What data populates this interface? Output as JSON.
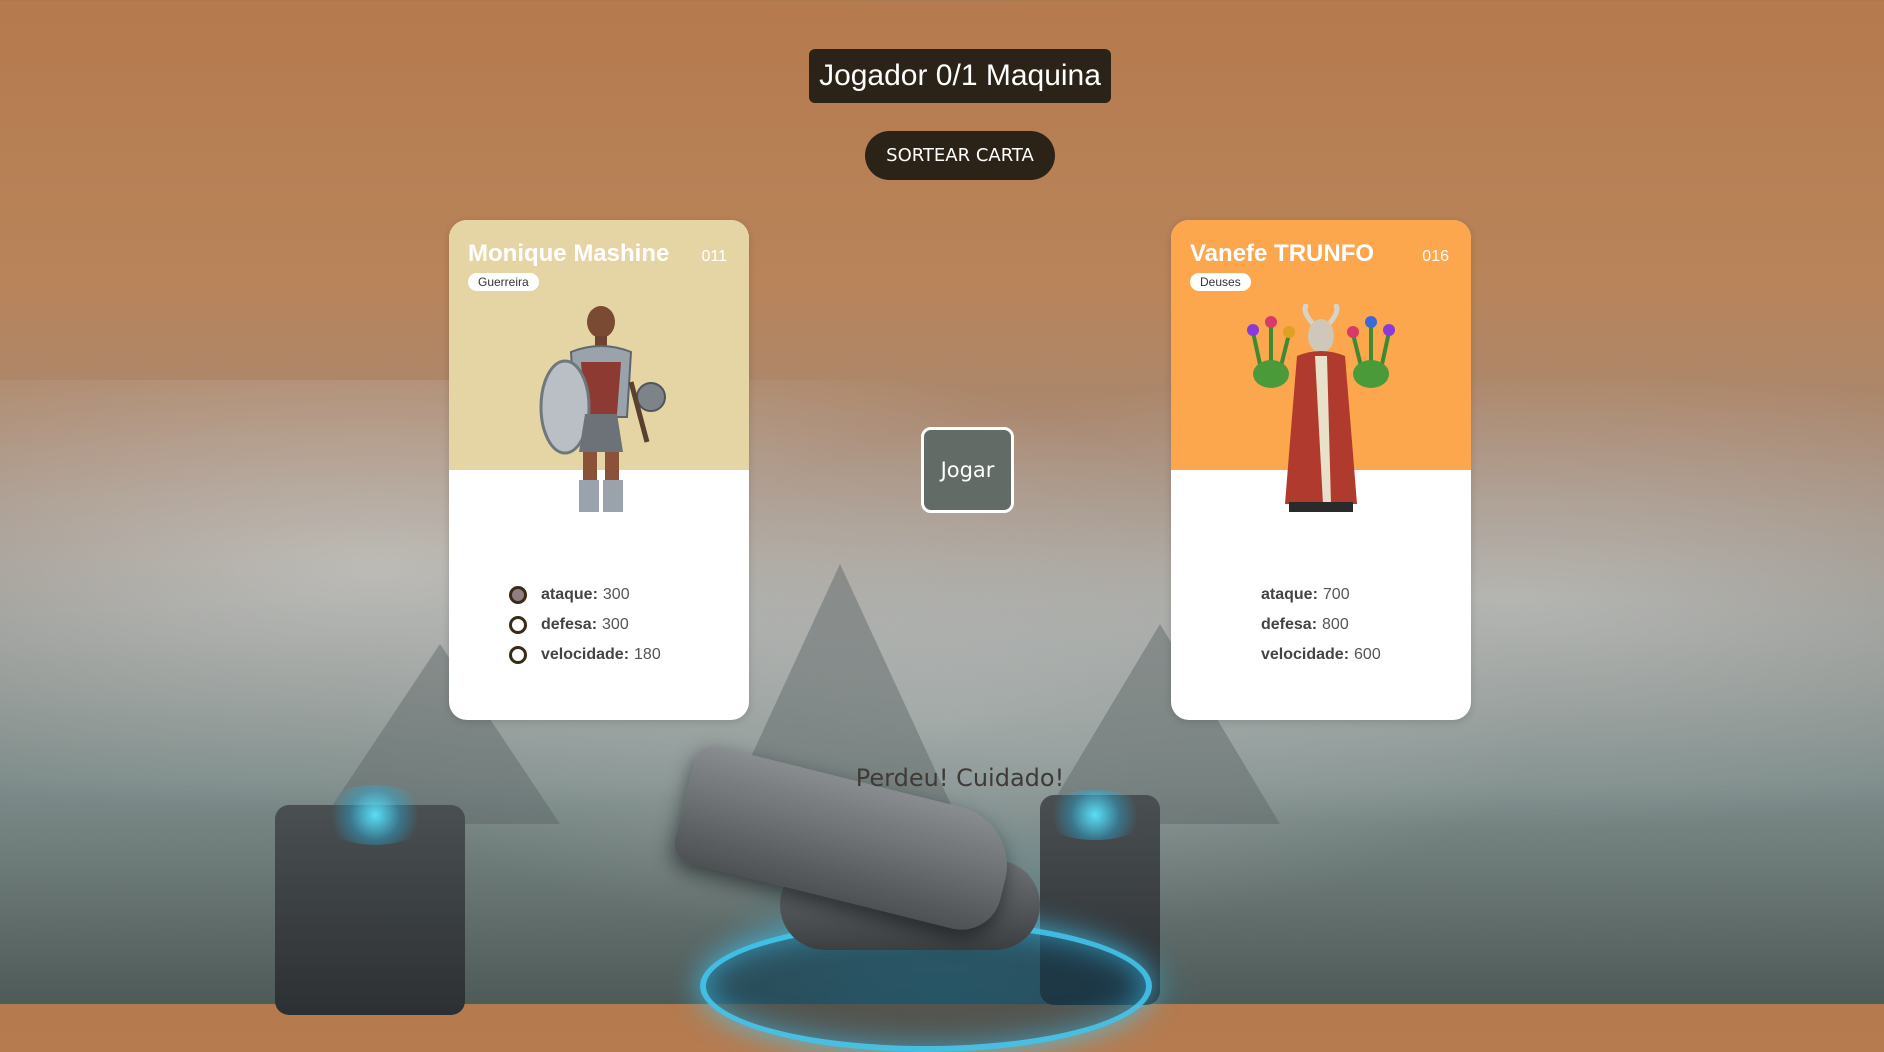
{
  "scoreboard": {
    "text": "Jogador 0/1 Maquina"
  },
  "draw_button": {
    "label": "SORTEAR CARTA"
  },
  "play_button": {
    "label": "Jogar"
  },
  "result_message": "Perdeu! Cuidado!",
  "player_card": {
    "name": "Monique Mashine",
    "number": "011",
    "type": "Guerreira",
    "header_color": "#e6d5a4",
    "figure": "armored-warrior-figure",
    "stats": [
      {
        "label": "ataque:",
        "value": "300",
        "selected": true
      },
      {
        "label": "defesa:",
        "value": "300",
        "selected": false
      },
      {
        "label": "velocidade:",
        "value": "180",
        "selected": false
      }
    ]
  },
  "machine_card": {
    "name": "Vanefe TRUNFO",
    "number": "016",
    "type": "Deuses",
    "header_color": "#fca64e",
    "figure": "goat-god-with-flowers-figure",
    "stats": [
      {
        "label": "ataque:",
        "value": "700"
      },
      {
        "label": "defesa:",
        "value": "800"
      },
      {
        "label": "velocidade:",
        "value": "600"
      }
    ]
  }
}
